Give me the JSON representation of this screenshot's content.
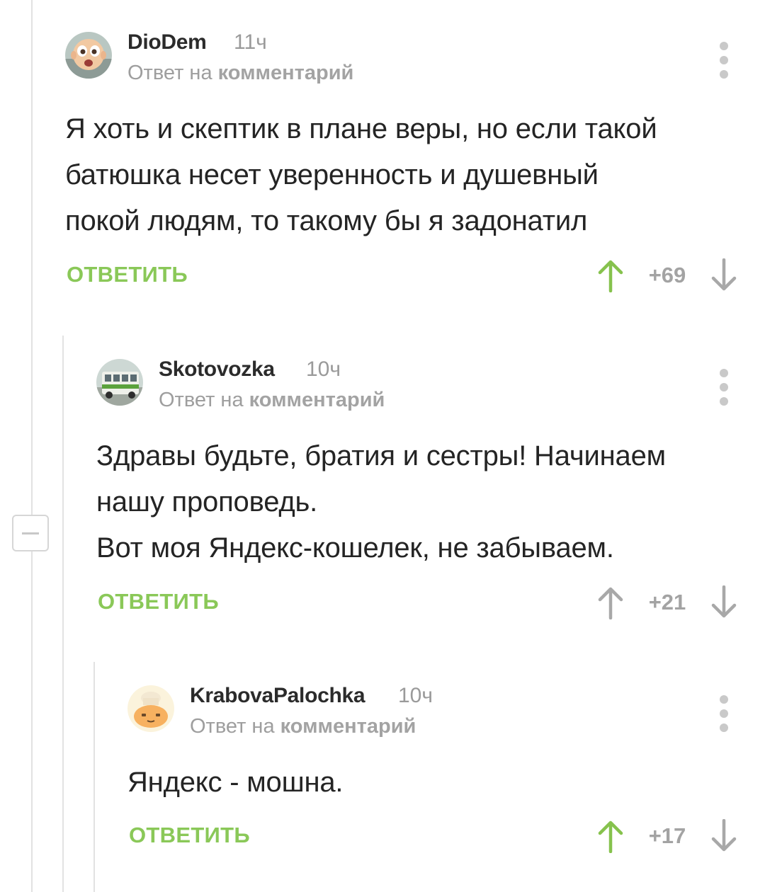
{
  "colors": {
    "accent_green": "#8ac858",
    "muted_text": "#9e9e9e",
    "thread_line": "#e2e2e2",
    "vote_arrow_neutral": "#a8a8a8"
  },
  "collapse_button": {
    "icon": "minus-icon"
  },
  "comments": [
    {
      "username": "DioDem",
      "time": "11ч",
      "reply_prefix": "Ответ на",
      "reply_link": "комментарий",
      "body_lines": [
        "Я хоть и скептик в плане веры, но если такой",
        "батюшка несет уверенность и душевный",
        "покой людям, то такому бы я задонатил"
      ],
      "reply_label": "ОТВЕТИТЬ",
      "rating": "+69",
      "upvoted": true,
      "avatar_icon": "baby-avatar-icon"
    },
    {
      "username": "Skotovozka",
      "time": "10ч",
      "reply_prefix": "Ответ на",
      "reply_link": "комментарий",
      "body_lines": [
        "Здравы будьте, братия и сестры! Начинаем",
        "нашу проповедь.",
        "Вот моя Яндекс-кошелек, не забываем."
      ],
      "reply_label": "ОТВЕТИТЬ",
      "rating": "+21",
      "upvoted": false,
      "avatar_icon": "bus-avatar-icon"
    },
    {
      "username": "KrabovaPalochka",
      "time": "10ч",
      "reply_prefix": "Ответ на",
      "reply_link": "комментарий",
      "body_lines": [
        "Яндекс - мошна."
      ],
      "reply_label": "ОТВЕТИТЬ",
      "rating": "+17",
      "upvoted": true,
      "avatar_icon": "chef-avatar-icon"
    }
  ]
}
